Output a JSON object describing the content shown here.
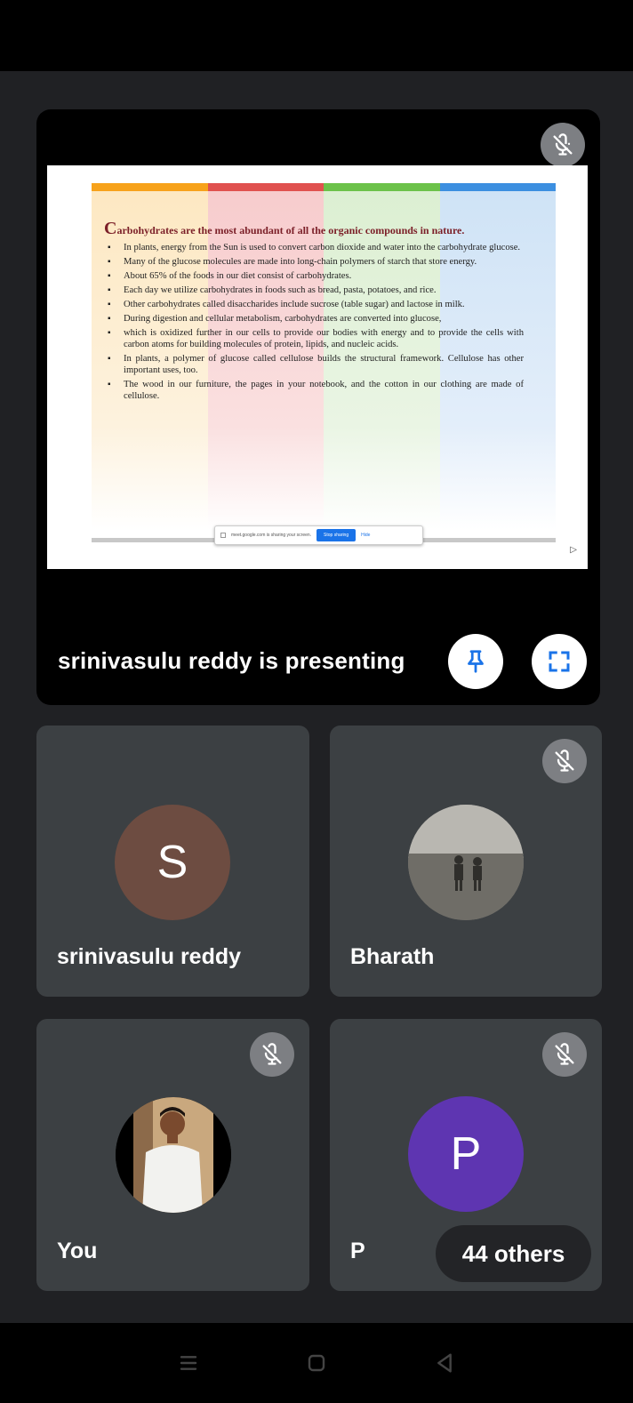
{
  "presentation": {
    "presenting_text": "srinivasulu reddy is presenting",
    "slide": {
      "heading_dropcap": "C",
      "heading_rest": "arbohydrates are the most abundant of all the organic compounds in nature.",
      "bullets": [
        "In plants, energy from the Sun is used to convert carbon dioxide and water into the carbohydrate glucose.",
        "Many of the glucose molecules are made into long-chain polymers of starch that store energy.",
        "About 65% of the foods in our diet consist of carbohydrates.",
        "Each day we utilize carbohydrates in foods such as bread, pasta, potatoes, and rice.",
        "Other carbohydrates called disaccharides include sucrose (table sugar) and lactose in milk.",
        "During digestion and cellular metabolism, carbohydrates are converted into glucose,",
        "which is oxidized further in our cells to provide our bodies with energy and to provide the cells with carbon atoms for building molecules of protein, lipids, and nucleic acids.",
        "In plants, a polymer of glucose called cellulose builds the structural framework. Cellulose has other important uses, too.",
        "The wood in our furniture, the pages in your notebook, and the cotton in our clothing are made of cellulose."
      ],
      "share_bar": {
        "message": "meet.google.com is sharing your screen.",
        "stop_label": "Stop sharing",
        "hide_label": "Hide"
      }
    }
  },
  "participants": [
    {
      "name": "srinivasulu reddy",
      "initial": "S",
      "avatar_color": "#6d4c41",
      "muted": false
    },
    {
      "name": "Bharath",
      "initial": "",
      "avatar_color": "#8a8a84",
      "muted": true
    },
    {
      "name": "You",
      "initial": "",
      "avatar_color": "#000000",
      "muted": true
    },
    {
      "name": "P",
      "initial": "P",
      "avatar_color": "#5e35b1",
      "muted": true
    }
  ],
  "others_count_label": "44 others",
  "colors": {
    "background": "#202124",
    "tile": "#3c4043",
    "muted_badge": "#7d7f83",
    "accent_blue": "#1a73e8"
  }
}
